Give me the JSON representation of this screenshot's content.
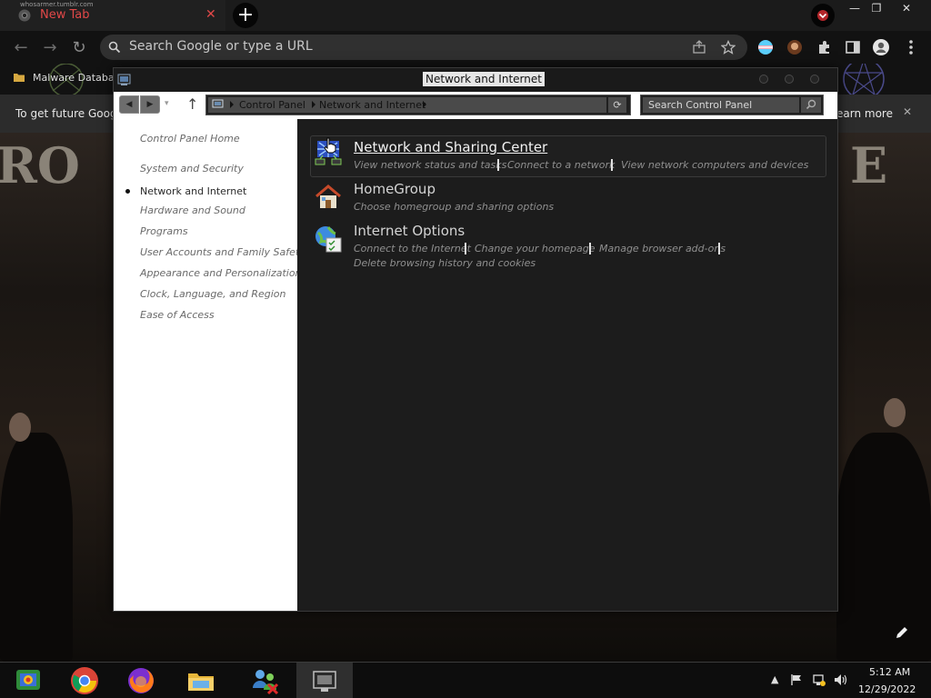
{
  "browser": {
    "tab": {
      "url_ghost": "whosarmer.tumblr.com",
      "title": "New Tab",
      "close_glyph": "✕",
      "favicon": "chrome-favicon-icon"
    },
    "new_tab_glyph": "+",
    "window_controls": {
      "minimize": "—",
      "maximize": "❐",
      "close": "✕"
    },
    "nav": {
      "back": "←",
      "forward": "→",
      "reload": "↻"
    },
    "omnibox": {
      "placeholder": "Search Google or type a URL"
    },
    "bookmark": {
      "label": "Malware Databa"
    },
    "infobar": {
      "text": "To get future Goog",
      "learn_more": "earn more",
      "close": "✕"
    },
    "accent": "#e14848"
  },
  "wallpaper": {
    "left_text": "RO",
    "right_text": "E"
  },
  "control_panel": {
    "title": "Network and Internet",
    "address": {
      "crumbs": [
        "Control Panel",
        "Network and Internet"
      ]
    },
    "search_placeholder": "Search Control Panel",
    "nav": {
      "home": "Control Panel Home",
      "items": [
        "System and Security",
        "Network and Internet",
        "Hardware and Sound",
        "Programs",
        "User Accounts and Family Safety",
        "Appearance and Personalization",
        "Clock, Language, and Region",
        "Ease of Access"
      ]
    },
    "categories": [
      {
        "title": "Network and Sharing Center",
        "icon": "network-icon",
        "links": [
          "View network status and tasks",
          "Connect to a network",
          "View network computers and devices"
        ]
      },
      {
        "title": "HomeGroup",
        "icon": "homegroup-icon",
        "links": [
          "Choose homegroup and sharing options"
        ]
      },
      {
        "title": "Internet Options",
        "icon": "internet-options-icon",
        "links": [
          "Connect to the Internet",
          "Change your homepage",
          "Manage browser add-ons",
          "Delete browsing history and cookies"
        ]
      }
    ]
  },
  "taskbar": {
    "apps": [
      "control-panel-icon",
      "chrome-icon",
      "firefox-icon",
      "file-explorer-icon",
      "network-users-icon",
      "control-panel-window-icon"
    ],
    "clock": {
      "time": "5:12 AM",
      "date": "12/29/2022"
    }
  }
}
